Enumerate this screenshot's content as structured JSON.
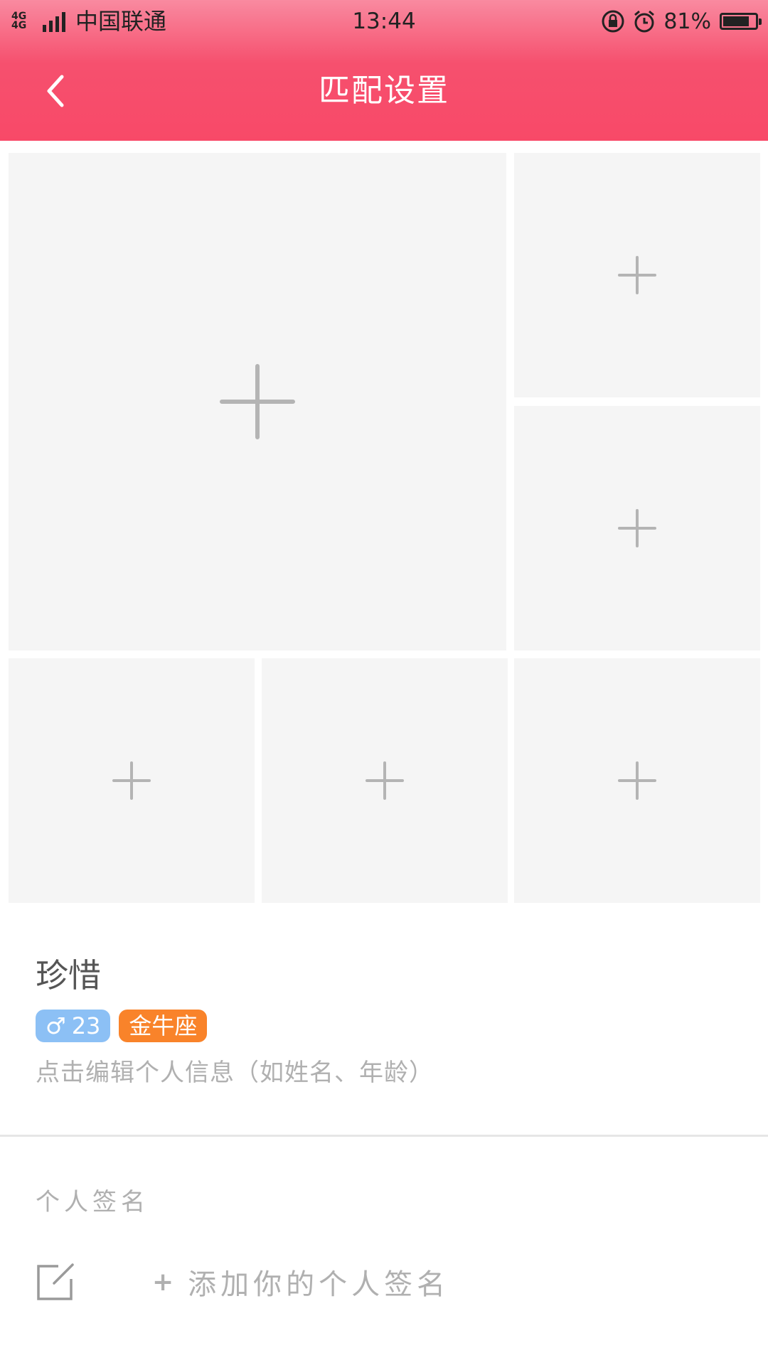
{
  "status_bar": {
    "network": "4G 4G",
    "carrier": "中国联通",
    "time": "13:44",
    "battery_percent": "81%",
    "battery_level": 0.81,
    "icons": [
      "signal-icon",
      "rotation-lock-icon",
      "alarm-icon",
      "battery-icon"
    ]
  },
  "header": {
    "title": "匹配设置",
    "back_icon": "chevron-left-icon",
    "gradient_top": "#f98aa0",
    "gradient_bottom": "#f84968"
  },
  "photo_grid": {
    "tiles": [
      {
        "slot": "main",
        "icon": "plus-icon"
      },
      {
        "slot": "2",
        "icon": "plus-icon"
      },
      {
        "slot": "3",
        "icon": "plus-icon"
      },
      {
        "slot": "4",
        "icon": "plus-icon"
      },
      {
        "slot": "5",
        "icon": "plus-icon"
      },
      {
        "slot": "6",
        "icon": "plus-icon"
      }
    ],
    "tile_color": "#f5f5f5"
  },
  "profile": {
    "name": "珍惜",
    "gender_symbol": "♂",
    "age": "23",
    "zodiac": "金牛座",
    "edit_hint": "点击编辑个人信息（如姓名、年龄）",
    "gender_badge_color": "#8cc0f5",
    "zodiac_badge_color": "#f9832a"
  },
  "signature": {
    "section_title": "个人签名",
    "add_plus": "+",
    "add_label": "添加你的个人签名",
    "edit_icon": "edit-icon"
  }
}
